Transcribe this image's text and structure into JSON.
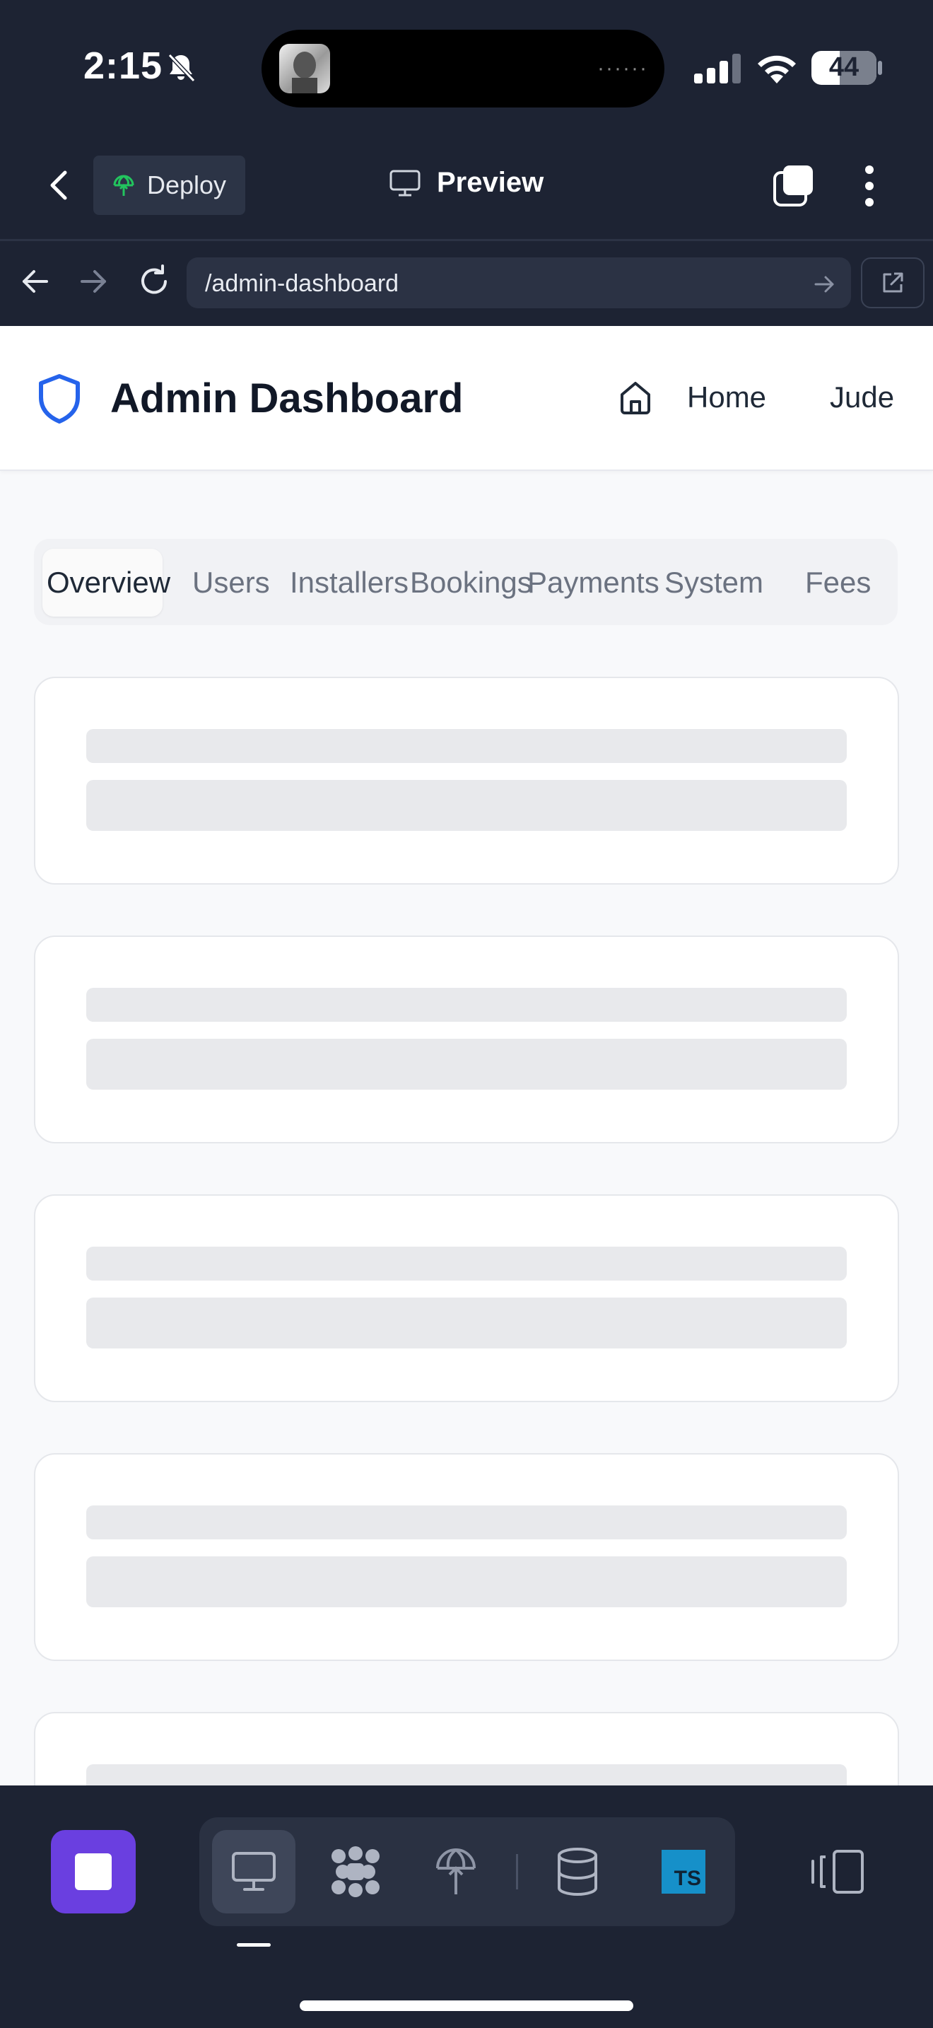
{
  "status_bar": {
    "time": "2:15",
    "battery": "44"
  },
  "header": {
    "deploy_label": "Deploy",
    "title": "Preview"
  },
  "browser": {
    "url": "/admin-dashboard"
  },
  "app": {
    "title": "Admin Dashboard",
    "nav_home": "Home",
    "nav_user": "Jude"
  },
  "tabs": [
    {
      "label": "Overview",
      "active": true
    },
    {
      "label": "Users",
      "active": false
    },
    {
      "label": "Installers",
      "active": false
    },
    {
      "label": "Bookings",
      "active": false
    },
    {
      "label": "Payments",
      "active": false
    },
    {
      "label": "System",
      "active": false
    },
    {
      "label": "Fees",
      "active": false
    }
  ],
  "colors": {
    "chrome_bg": "#1d2333",
    "accent_purple": "#6a3fe0",
    "shield_blue": "#2563eb",
    "deploy_green": "#22c55e",
    "ts_blue": "#1690c9"
  },
  "icons": {
    "bell": "bell-slash-icon",
    "back": "chevron-left-icon",
    "deploy": "deploy-globe-icon",
    "preview": "monitor-icon",
    "tabs": "tabs-icon",
    "menu": "more-vertical-icon",
    "shield": "shield-icon",
    "home": "home-icon",
    "database": "database-icon",
    "typescript": "typescript-icon"
  },
  "bottom_bar": {
    "ts_badge": "TS"
  }
}
